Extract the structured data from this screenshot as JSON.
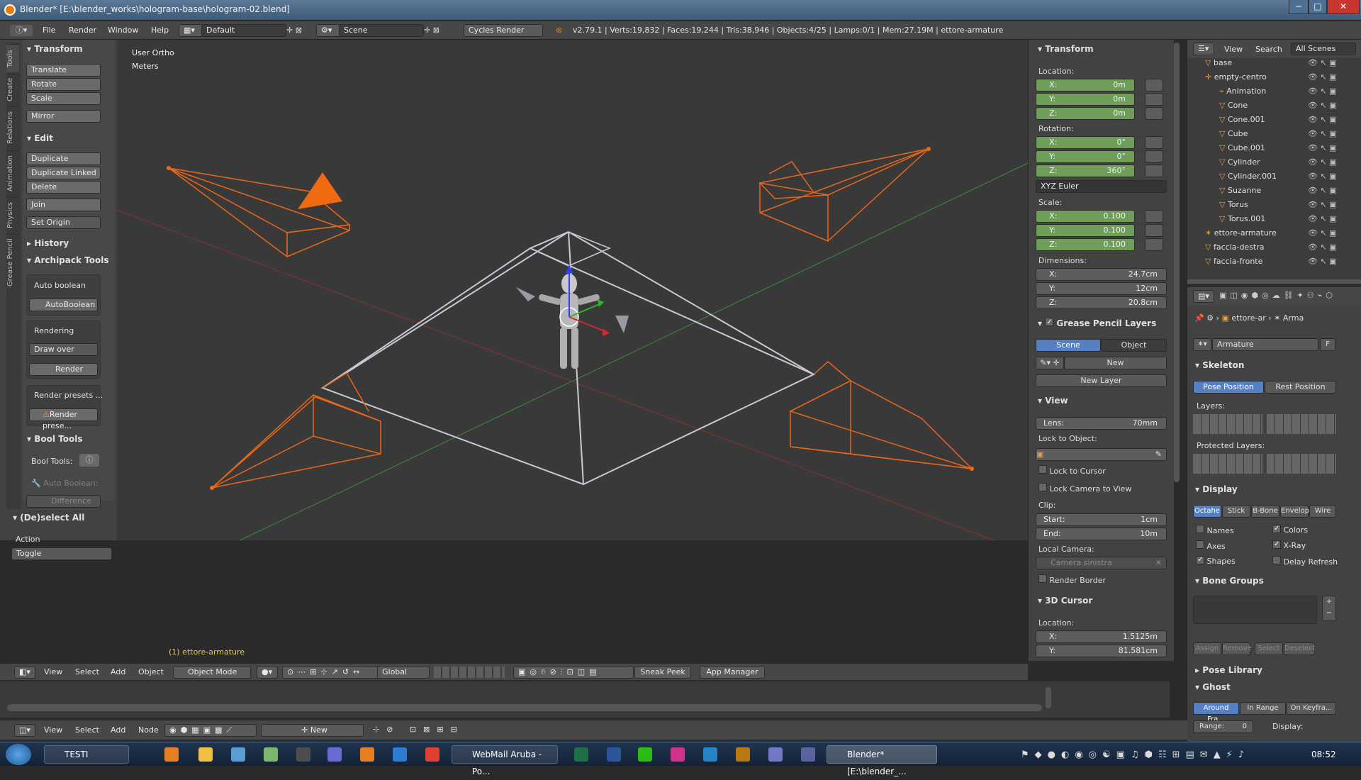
{
  "window": {
    "title": "Blender* [E:\\blender_works\\hologram-base\\hologram-02.blend]",
    "min": "─",
    "max": "□",
    "close": "✕"
  },
  "menu": {
    "file": "File",
    "render": "Render",
    "window": "Window",
    "help": "Help",
    "layout": "Default",
    "scene": "Scene",
    "engine": "Cycles Render",
    "stats": "v2.79.1 | Verts:19,832 | Faces:19,244 | Tris:38,946 | Objects:4/25 | Lamps:0/1 | Mem:27.19M | ettore-armature"
  },
  "tabs": [
    "Tools",
    "Create",
    "Relations",
    "Animation",
    "Physics",
    "Grease Pencil"
  ],
  "tools": {
    "transform_h": "Transform",
    "translate": "Translate",
    "rotate": "Rotate",
    "scale": "Scale",
    "mirror": "Mirror",
    "edit_h": "Edit",
    "duplicate": "Duplicate",
    "duplicate_linked": "Duplicate Linked",
    "delete": "Delete",
    "join": "Join",
    "set_origin": "Set Origin",
    "history_h": "History",
    "archipack_h": "Archipack Tools",
    "auto_boolean_lbl": "Auto boolean",
    "auto_boolean_btn": "AutoBoolean",
    "rendering_lbl": "Rendering",
    "draw_over": "Draw over",
    "render_btn": "Render",
    "render_presets_lbl": "Render presets ...",
    "render_prese_btn": "Render prese...",
    "booltools_h": "Bool Tools",
    "booltools_lbl": "Bool Tools:",
    "auto_boolean_dim": "Auto Boolean:",
    "difference": "Difference",
    "deselect_h": "(De)select All",
    "action_lbl": "Action",
    "toggle": "Toggle"
  },
  "viewport": {
    "view_name": "User Ortho",
    "units": "Meters",
    "selected": "(1) ettore-armature"
  },
  "vheader": {
    "view": "View",
    "select": "Select",
    "add": "Add",
    "object": "Object",
    "mode": "Object Mode",
    "orientation": "Global",
    "sneak": "Sneak Peek",
    "app": "App Manager"
  },
  "nodeheader": {
    "view": "View",
    "select": "Select",
    "add": "Add",
    "node": "Node",
    "new": "New"
  },
  "npanel": {
    "transform_h": "Transform",
    "location_lbl": "Location:",
    "loc_x": "0m",
    "loc_y": "0m",
    "loc_z": "0m",
    "rotation_lbl": "Rotation:",
    "rot_x": "0°",
    "rot_y": "0°",
    "rot_z": "360°",
    "euler": "XYZ Euler",
    "scale_lbl": "Scale:",
    "sc_x": "0.100",
    "sc_y": "0.100",
    "sc_z": "0.100",
    "dims_lbl": "Dimensions:",
    "dim_x": "24.7cm",
    "dim_y": "12cm",
    "dim_z": "20.8cm",
    "gp_h": "Grease Pencil Layers",
    "gp_scene": "Scene",
    "gp_object": "Object",
    "gp_new": "New",
    "gp_newlayer": "New Layer",
    "view_h": "View",
    "lens_lbl": "Lens:",
    "lens": "70mm",
    "lock_obj": "Lock to Object:",
    "lock_cursor": "Lock to Cursor",
    "lock_cam": "Lock Camera to View",
    "clip_lbl": "Clip:",
    "start_lbl": "Start:",
    "start": "1cm",
    "end_lbl": "End:",
    "end": "10m",
    "local_cam": "Local Camera:",
    "cam_name": "Camera.sinistra",
    "render_border": "Render Border",
    "cursor_h": "3D Cursor",
    "cur_loc": "Location:",
    "cur_x": "1.5125m",
    "cur_y": "81.581cm",
    "x": "X:",
    "y": "Y:",
    "z": "Z:"
  },
  "outliner": {
    "view": "View",
    "search": "Search",
    "all_scenes": "All Scenes",
    "items": [
      "base",
      "empty-centro",
      "Animation",
      "Cone",
      "Cone.001",
      "Cube",
      "Cube.001",
      "Cylinder",
      "Cylinder.001",
      "Suzanne",
      "Torus",
      "Torus.001",
      "ettore-armature",
      "faccia-destra",
      "faccia-fronte"
    ]
  },
  "props": {
    "breadcrumb_obj": "ettore-ar",
    "breadcrumb_data": "Arma",
    "armature_name": "Armature",
    "f": "F",
    "skeleton_h": "Skeleton",
    "pose_pos": "Pose Position",
    "rest_pos": "Rest Position",
    "layers_lbl": "Layers:",
    "protected_lbl": "Protected Layers:",
    "display_h": "Display",
    "d_octa": "Octahe",
    "d_stick": "Stick",
    "d_bbone": "B-Bone",
    "d_env": "Envelop",
    "d_wire": "Wire",
    "names": "Names",
    "colors": "Colors",
    "axes": "Axes",
    "xray": "X-Ray",
    "shapes": "Shapes",
    "delay": "Delay Refresh",
    "bonegroups_h": "Bone Groups",
    "assign": "Assign",
    "remove": "Remove",
    "select": "Select",
    "deselect": "Deselect",
    "poselib_h": "Pose Library",
    "ghost_h": "Ghost",
    "around": "Around Fra...",
    "inrange": "In Range",
    "onkey": "On Keyfra...",
    "range_lbl": "Range:",
    "range": "0",
    "display_lbl": "Display:"
  },
  "taskbar": {
    "testi": "TESTI",
    "webmail": "WebMail Aruba - Po...",
    "blender": "Blender* [E:\\blender_...",
    "time": "08:52"
  },
  "colors": {
    "accent": "#5680c2",
    "orange": "#f26a10",
    "green_field": "#6f9e5a"
  }
}
